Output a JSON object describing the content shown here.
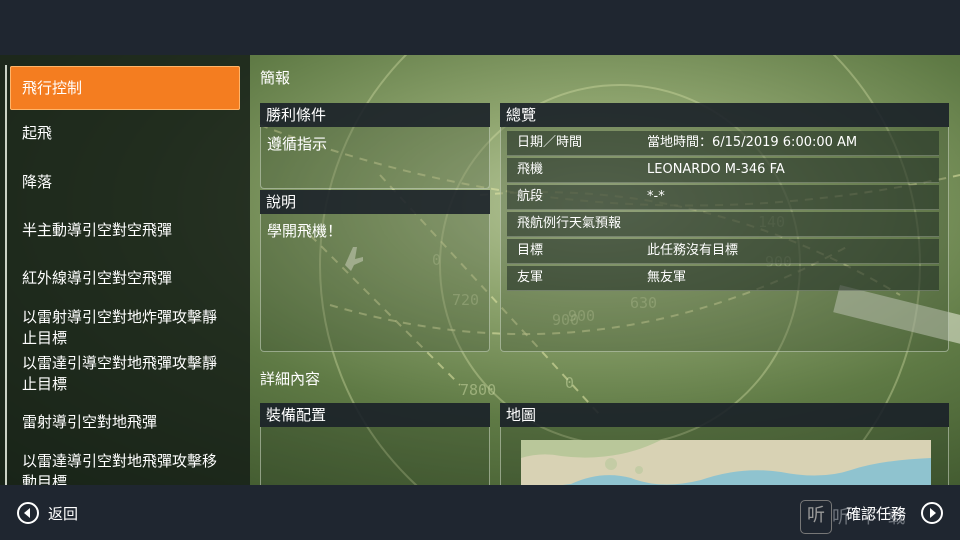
{
  "sidebar": {
    "items": [
      {
        "label": "飛行控制",
        "active": true
      },
      {
        "label": "起飛"
      },
      {
        "label": "降落"
      },
      {
        "label": "半主動導引空對空飛彈"
      },
      {
        "label": "紅外線導引空對空飛彈"
      },
      {
        "label": "以雷射導引空對地炸彈攻擊靜止目標"
      },
      {
        "label": "以雷達引導空對地飛彈攻擊靜止目標"
      },
      {
        "label": "雷射導引空對地飛彈"
      },
      {
        "label": "以雷達導引空對地飛彈攻擊移動目標"
      }
    ]
  },
  "briefing": {
    "section_title": "簡報",
    "victory": {
      "title": "勝利條件",
      "text": "遵循指示"
    },
    "description": {
      "title": "說明",
      "text": "學開飛機！"
    },
    "overview": {
      "title": "總覽",
      "rows": [
        {
          "key": "日期／時間",
          "value": "當地時間：6/15/2019 6:00:00 AM"
        },
        {
          "key": "飛機",
          "value": "LEONARDO M-346 FA"
        },
        {
          "key": "航段",
          "value": "*-*"
        },
        {
          "key": "飛航例行天氣預報",
          "value": ""
        },
        {
          "key": "目標",
          "value": "此任務沒有目標"
        },
        {
          "key": "友軍",
          "value": "無友軍"
        }
      ]
    }
  },
  "details": {
    "section_title": "詳細內容",
    "loadout": {
      "title": "裝備配置"
    },
    "map": {
      "title": "地圖"
    }
  },
  "background_numbers": [
    "0",
    "140",
    "900",
    "900",
    "630",
    "720",
    "900",
    "7800",
    "0"
  ],
  "bottom": {
    "back_label": "返回",
    "confirm_label": "確認任務",
    "watermark_text": "听 下 载"
  },
  "colors": {
    "accent": "#f47d20",
    "bar": "#1f2630"
  }
}
